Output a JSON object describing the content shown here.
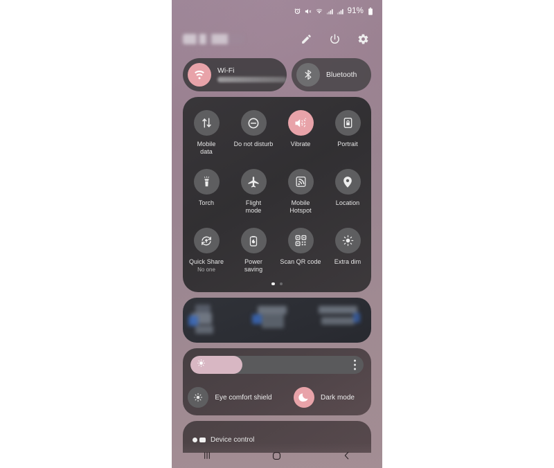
{
  "status_bar": {
    "icons": [
      "alarm-icon",
      "mute-icon",
      "wifi-icon",
      "signal-sim1-icon",
      "signal-sim2-icon"
    ],
    "battery_percent": "91%"
  },
  "header": {
    "title_redacted": "",
    "actions": [
      {
        "name": "edit-icon",
        "label": "Edit"
      },
      {
        "name": "power-icon",
        "label": "Power off"
      },
      {
        "name": "settings-icon",
        "label": "Settings"
      }
    ]
  },
  "connection_pills": [
    {
      "label": "Wi-Fi",
      "sublabel_redacted": "",
      "state": "on",
      "icon": "wifi-icon"
    },
    {
      "label": "Bluetooth",
      "sublabel_redacted": "",
      "state": "off",
      "icon": "bluetooth-icon"
    }
  ],
  "quick_settings": {
    "rows": [
      [
        {
          "label": "Mobile\ndata",
          "label_line1": "Mobile",
          "label_line2": "data",
          "state": "off",
          "icon": "mobile-data-icon"
        },
        {
          "label": "Do not disturb",
          "label_line1": "Do not disturb",
          "label_line2": "",
          "state": "off",
          "icon": "do-not-disturb-icon"
        },
        {
          "label": "Vibrate",
          "label_line1": "Vibrate",
          "label_line2": "",
          "state": "on",
          "icon": "vibrate-icon"
        },
        {
          "label": "Portrait",
          "label_line1": "Portrait",
          "label_line2": "",
          "state": "off",
          "icon": "rotation-lock-icon"
        }
      ],
      [
        {
          "label": "Torch",
          "label_line1": "Torch",
          "label_line2": "",
          "state": "off",
          "icon": "torch-icon"
        },
        {
          "label": "Flight mode",
          "label_line1": "Flight",
          "label_line2": "mode",
          "state": "off",
          "icon": "airplane-icon"
        },
        {
          "label": "Mobile Hotspot",
          "label_line1": "Mobile",
          "label_line2": "Hotspot",
          "state": "off",
          "icon": "hotspot-icon"
        },
        {
          "label": "Location",
          "label_line1": "Location",
          "label_line2": "",
          "state": "off",
          "icon": "location-pin-icon",
          "highlighted": true
        }
      ],
      [
        {
          "label": "Quick Share",
          "label_line1": "Quick Share",
          "label_line2": "",
          "sublabel": "No one",
          "state": "off",
          "icon": "quick-share-icon"
        },
        {
          "label": "Power saving",
          "label_line1": "Power",
          "label_line2": "saving",
          "state": "off",
          "icon": "power-saving-icon"
        },
        {
          "label": "Scan QR code",
          "label_line1": "Scan QR code",
          "label_line2": "",
          "state": "off",
          "icon": "qr-code-icon"
        },
        {
          "label": "Extra dim",
          "label_line1": "Extra dim",
          "label_line2": "",
          "state": "off",
          "icon": "extra-dim-icon"
        }
      ]
    ],
    "page_dots": {
      "count": 2,
      "active_index": 0
    }
  },
  "media_card": {
    "redacted": true
  },
  "brightness": {
    "level_percent": 30,
    "more_options_icon": "more-vertical-icon",
    "modes": [
      {
        "label": "Eye comfort shield",
        "state": "off",
        "icon": "eye-comfort-icon"
      },
      {
        "label": "Dark mode",
        "state": "on",
        "icon": "moon-icon"
      }
    ]
  },
  "device_control": {
    "label": "Device control"
  },
  "nav_bar": [
    {
      "name": "recents-button",
      "label": "Recents"
    },
    {
      "name": "home-button",
      "label": "Home"
    },
    {
      "name": "back-button",
      "label": "Back"
    }
  ],
  "colors": {
    "accent_on": "#e8a3a9",
    "toggle_off": "#5e5e60",
    "panel_bg": "#2e2e30",
    "annotation": "#ff0000",
    "slider_fill": "#d8b7c3"
  }
}
